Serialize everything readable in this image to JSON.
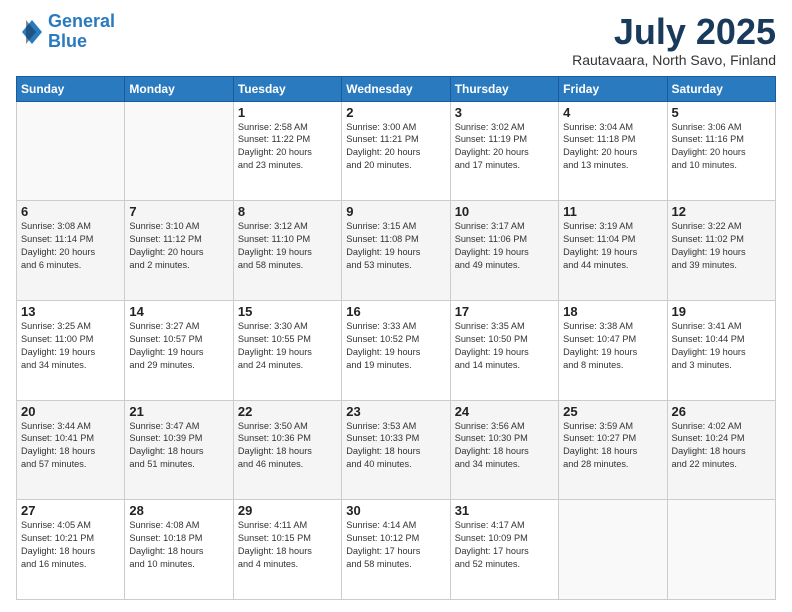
{
  "header": {
    "logo_line1": "General",
    "logo_line2": "Blue",
    "month_title": "July 2025",
    "location": "Rautavaara, North Savo, Finland"
  },
  "weekdays": [
    "Sunday",
    "Monday",
    "Tuesday",
    "Wednesday",
    "Thursday",
    "Friday",
    "Saturday"
  ],
  "weeks": [
    [
      {
        "day": "",
        "info": ""
      },
      {
        "day": "",
        "info": ""
      },
      {
        "day": "1",
        "info": "Sunrise: 2:58 AM\nSunset: 11:22 PM\nDaylight: 20 hours\nand 23 minutes."
      },
      {
        "day": "2",
        "info": "Sunrise: 3:00 AM\nSunset: 11:21 PM\nDaylight: 20 hours\nand 20 minutes."
      },
      {
        "day": "3",
        "info": "Sunrise: 3:02 AM\nSunset: 11:19 PM\nDaylight: 20 hours\nand 17 minutes."
      },
      {
        "day": "4",
        "info": "Sunrise: 3:04 AM\nSunset: 11:18 PM\nDaylight: 20 hours\nand 13 minutes."
      },
      {
        "day": "5",
        "info": "Sunrise: 3:06 AM\nSunset: 11:16 PM\nDaylight: 20 hours\nand 10 minutes."
      }
    ],
    [
      {
        "day": "6",
        "info": "Sunrise: 3:08 AM\nSunset: 11:14 PM\nDaylight: 20 hours\nand 6 minutes."
      },
      {
        "day": "7",
        "info": "Sunrise: 3:10 AM\nSunset: 11:12 PM\nDaylight: 20 hours\nand 2 minutes."
      },
      {
        "day": "8",
        "info": "Sunrise: 3:12 AM\nSunset: 11:10 PM\nDaylight: 19 hours\nand 58 minutes."
      },
      {
        "day": "9",
        "info": "Sunrise: 3:15 AM\nSunset: 11:08 PM\nDaylight: 19 hours\nand 53 minutes."
      },
      {
        "day": "10",
        "info": "Sunrise: 3:17 AM\nSunset: 11:06 PM\nDaylight: 19 hours\nand 49 minutes."
      },
      {
        "day": "11",
        "info": "Sunrise: 3:19 AM\nSunset: 11:04 PM\nDaylight: 19 hours\nand 44 minutes."
      },
      {
        "day": "12",
        "info": "Sunrise: 3:22 AM\nSunset: 11:02 PM\nDaylight: 19 hours\nand 39 minutes."
      }
    ],
    [
      {
        "day": "13",
        "info": "Sunrise: 3:25 AM\nSunset: 11:00 PM\nDaylight: 19 hours\nand 34 minutes."
      },
      {
        "day": "14",
        "info": "Sunrise: 3:27 AM\nSunset: 10:57 PM\nDaylight: 19 hours\nand 29 minutes."
      },
      {
        "day": "15",
        "info": "Sunrise: 3:30 AM\nSunset: 10:55 PM\nDaylight: 19 hours\nand 24 minutes."
      },
      {
        "day": "16",
        "info": "Sunrise: 3:33 AM\nSunset: 10:52 PM\nDaylight: 19 hours\nand 19 minutes."
      },
      {
        "day": "17",
        "info": "Sunrise: 3:35 AM\nSunset: 10:50 PM\nDaylight: 19 hours\nand 14 minutes."
      },
      {
        "day": "18",
        "info": "Sunrise: 3:38 AM\nSunset: 10:47 PM\nDaylight: 19 hours\nand 8 minutes."
      },
      {
        "day": "19",
        "info": "Sunrise: 3:41 AM\nSunset: 10:44 PM\nDaylight: 19 hours\nand 3 minutes."
      }
    ],
    [
      {
        "day": "20",
        "info": "Sunrise: 3:44 AM\nSunset: 10:41 PM\nDaylight: 18 hours\nand 57 minutes."
      },
      {
        "day": "21",
        "info": "Sunrise: 3:47 AM\nSunset: 10:39 PM\nDaylight: 18 hours\nand 51 minutes."
      },
      {
        "day": "22",
        "info": "Sunrise: 3:50 AM\nSunset: 10:36 PM\nDaylight: 18 hours\nand 46 minutes."
      },
      {
        "day": "23",
        "info": "Sunrise: 3:53 AM\nSunset: 10:33 PM\nDaylight: 18 hours\nand 40 minutes."
      },
      {
        "day": "24",
        "info": "Sunrise: 3:56 AM\nSunset: 10:30 PM\nDaylight: 18 hours\nand 34 minutes."
      },
      {
        "day": "25",
        "info": "Sunrise: 3:59 AM\nSunset: 10:27 PM\nDaylight: 18 hours\nand 28 minutes."
      },
      {
        "day": "26",
        "info": "Sunrise: 4:02 AM\nSunset: 10:24 PM\nDaylight: 18 hours\nand 22 minutes."
      }
    ],
    [
      {
        "day": "27",
        "info": "Sunrise: 4:05 AM\nSunset: 10:21 PM\nDaylight: 18 hours\nand 16 minutes."
      },
      {
        "day": "28",
        "info": "Sunrise: 4:08 AM\nSunset: 10:18 PM\nDaylight: 18 hours\nand 10 minutes."
      },
      {
        "day": "29",
        "info": "Sunrise: 4:11 AM\nSunset: 10:15 PM\nDaylight: 18 hours\nand 4 minutes."
      },
      {
        "day": "30",
        "info": "Sunrise: 4:14 AM\nSunset: 10:12 PM\nDaylight: 17 hours\nand 58 minutes."
      },
      {
        "day": "31",
        "info": "Sunrise: 4:17 AM\nSunset: 10:09 PM\nDaylight: 17 hours\nand 52 minutes."
      },
      {
        "day": "",
        "info": ""
      },
      {
        "day": "",
        "info": ""
      }
    ]
  ]
}
